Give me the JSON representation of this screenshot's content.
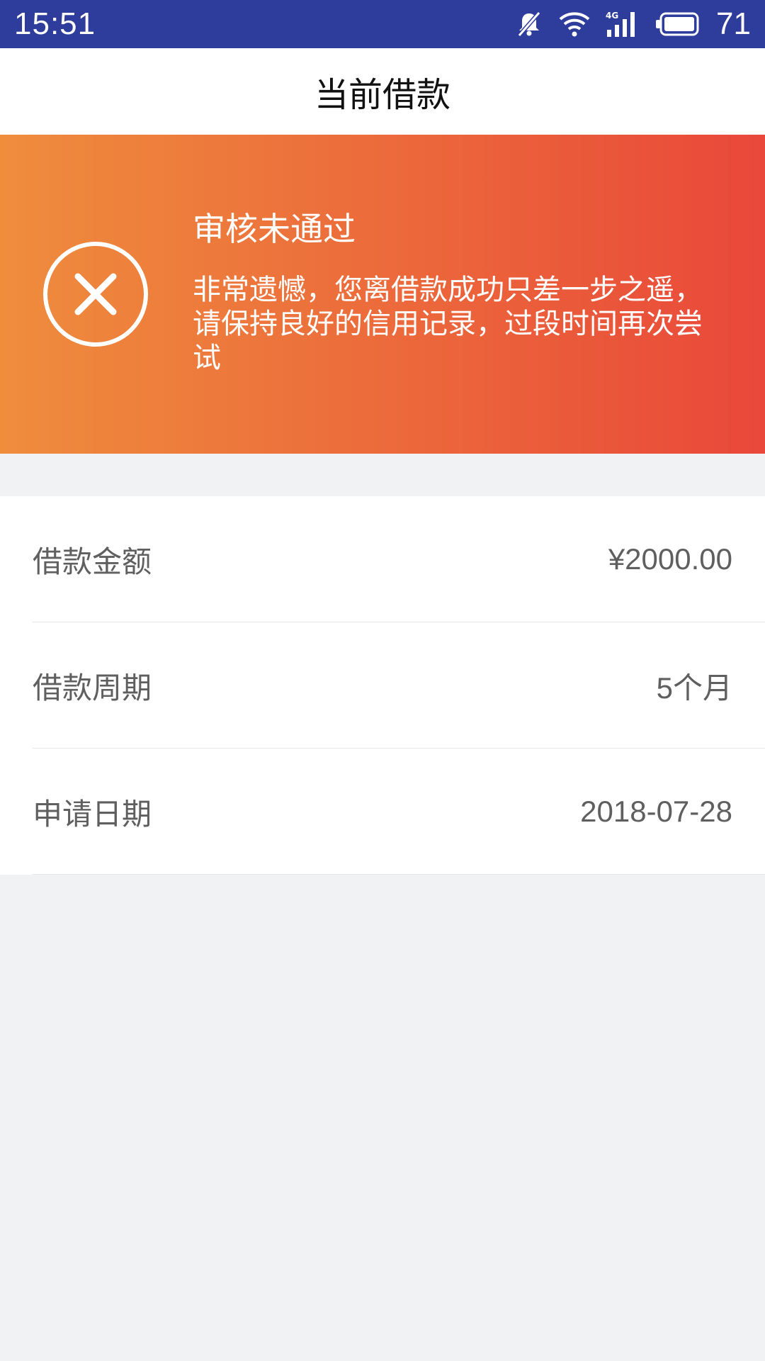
{
  "status_bar": {
    "time": "15:51",
    "battery_level": "71",
    "icons": [
      "mute-icon",
      "wifi-icon",
      "signal-4g-icon",
      "battery-icon"
    ],
    "network_label": "4G"
  },
  "header": {
    "title": "当前借款"
  },
  "banner": {
    "icon": "close-circle-icon",
    "title": "审核未通过",
    "message": "非常遗憾，您离借款成功只差一步之遥，请保持良好的信用记录，过段时间再次尝试",
    "gradient_start": "#ef8d3d",
    "gradient_end": "#e9483a"
  },
  "details": [
    {
      "label": "借款金额",
      "value": "¥2000.00"
    },
    {
      "label": "借款周期",
      "value": "5个月"
    },
    {
      "label": "申请日期",
      "value": "2018-07-28"
    }
  ],
  "colors": {
    "status_bar": "#2e3d9c",
    "page_background": "#f1f2f4"
  }
}
